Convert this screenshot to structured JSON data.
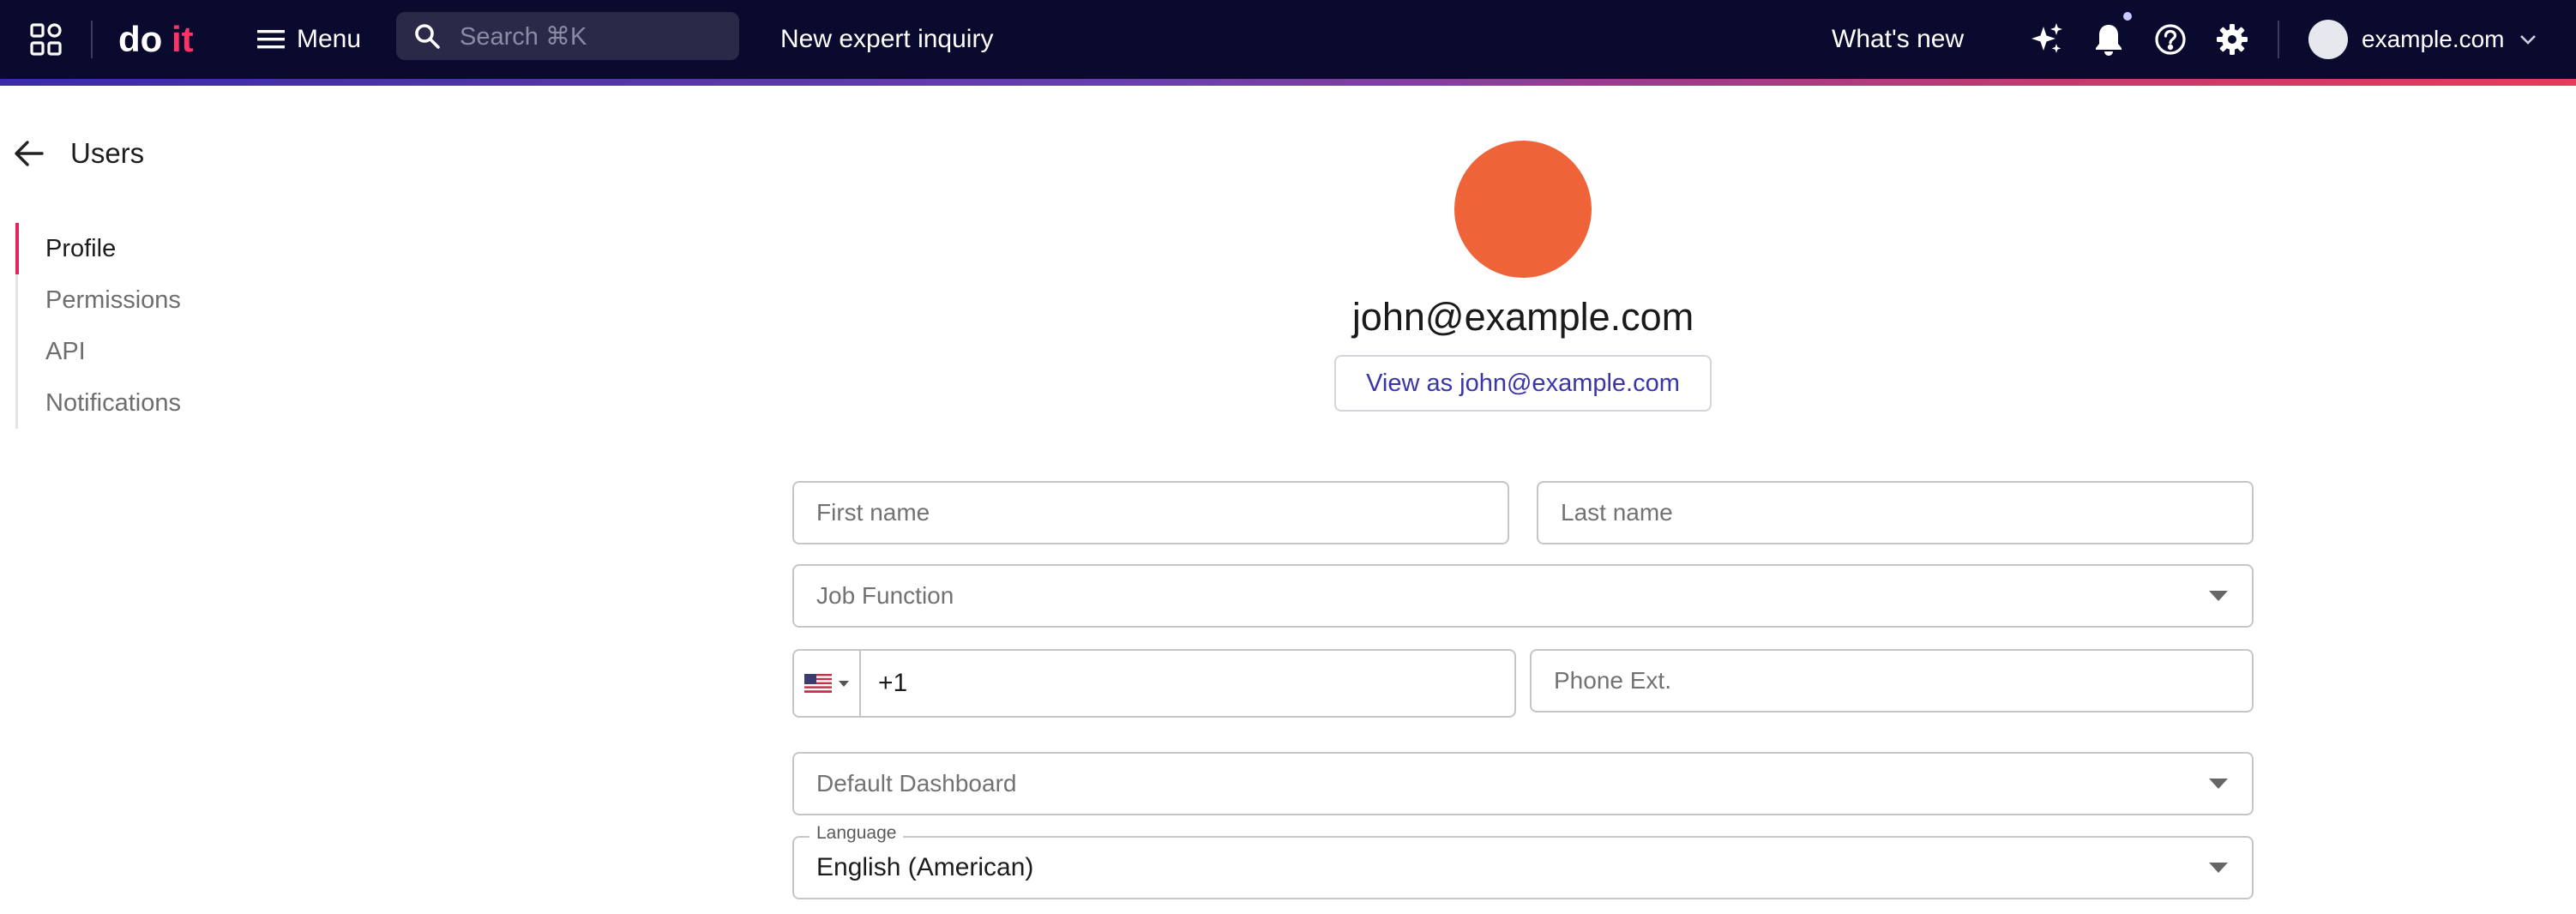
{
  "topbar": {
    "logo_text": "doit",
    "menu_label": "Menu",
    "search_placeholder": "Search ⌘K",
    "inquiry_label": "New expert inquiry",
    "whats_new_label": "What's new",
    "account_label": "example.com",
    "icons": [
      "apps-grid-icon",
      "hamburger-icon",
      "search-icon",
      "sparkle-icon",
      "bell-icon",
      "help-icon",
      "gear-icon",
      "chevron-down-icon"
    ]
  },
  "nav": {
    "back_title": "Users",
    "items": [
      {
        "label": "Profile",
        "active": true
      },
      {
        "label": "Permissions",
        "active": false
      },
      {
        "label": "API",
        "active": false
      },
      {
        "label": "Notifications",
        "active": false
      }
    ]
  },
  "profile": {
    "email": "john@example.com",
    "view_as_label": "View as john@example.com",
    "avatar_color": "#ee6338"
  },
  "form": {
    "first_name_placeholder": "First name",
    "last_name_placeholder": "Last name",
    "job_function_placeholder": "Job Function",
    "phone_value": "+1",
    "phone_country": "US",
    "phone_ext_placeholder": "Phone Ext.",
    "default_dashboard_placeholder": "Default Dashboard",
    "language_label": "Language",
    "language_value": "English (American)"
  },
  "colors": {
    "topbar_bg": "#0a0a2e",
    "accent": "#e0245e",
    "link": "#3a35a8"
  }
}
